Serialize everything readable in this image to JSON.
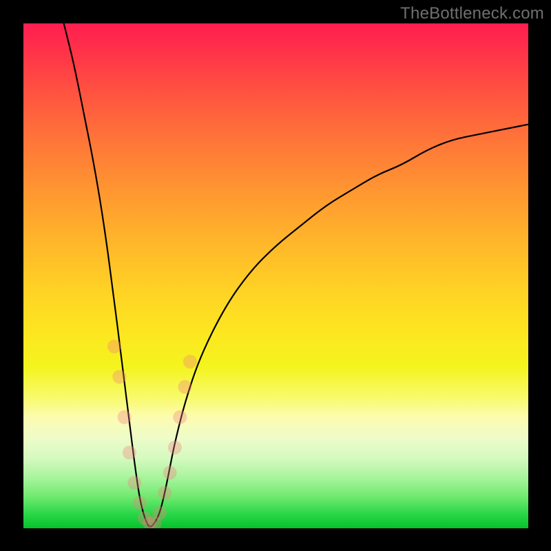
{
  "watermark": "TheBottleneck.com",
  "colors": {
    "frame": "#000000",
    "curve": "#000000",
    "marker": "#f08080",
    "gradient_top": "#ff1e50",
    "gradient_bottom": "#06c22c"
  },
  "chart_data": {
    "type": "line",
    "title": "",
    "xlabel": "",
    "ylabel": "",
    "xlim": [
      0,
      100
    ],
    "ylim": [
      0,
      100
    ],
    "grid": false,
    "legend": false,
    "notes": "Bottleneck-style V curve. Y ≈ 100 at x≈8, drops to ≈0 near x≈25, rises to ≈80 at x=100. No tick labels on either axis; values are estimated from relative pixel positions.",
    "x": [
      8,
      10,
      12,
      14,
      16,
      18,
      19,
      20,
      21,
      22,
      23,
      24,
      25,
      26,
      27,
      28,
      29,
      30,
      32,
      35,
      40,
      45,
      50,
      55,
      60,
      65,
      70,
      75,
      80,
      85,
      90,
      95,
      100
    ],
    "y": [
      100,
      92,
      82,
      72,
      60,
      45,
      37,
      29,
      21,
      13,
      6,
      2,
      0,
      1,
      3,
      7,
      12,
      17,
      25,
      34,
      44,
      51,
      56,
      60,
      64,
      67,
      70,
      72,
      75,
      77,
      78,
      79,
      80
    ],
    "markers": {
      "note": "Scattered pink dots visible near the valley of the curve.",
      "points": [
        {
          "x": 18,
          "y": 36
        },
        {
          "x": 19,
          "y": 30
        },
        {
          "x": 20,
          "y": 22
        },
        {
          "x": 21,
          "y": 15
        },
        {
          "x": 22,
          "y": 9
        },
        {
          "x": 23,
          "y": 5
        },
        {
          "x": 24,
          "y": 2
        },
        {
          "x": 25,
          "y": 1
        },
        {
          "x": 26,
          "y": 1
        },
        {
          "x": 27,
          "y": 3
        },
        {
          "x": 28,
          "y": 7
        },
        {
          "x": 29,
          "y": 11
        },
        {
          "x": 30,
          "y": 16
        },
        {
          "x": 31,
          "y": 22
        },
        {
          "x": 32,
          "y": 28
        },
        {
          "x": 33,
          "y": 33
        }
      ]
    }
  }
}
